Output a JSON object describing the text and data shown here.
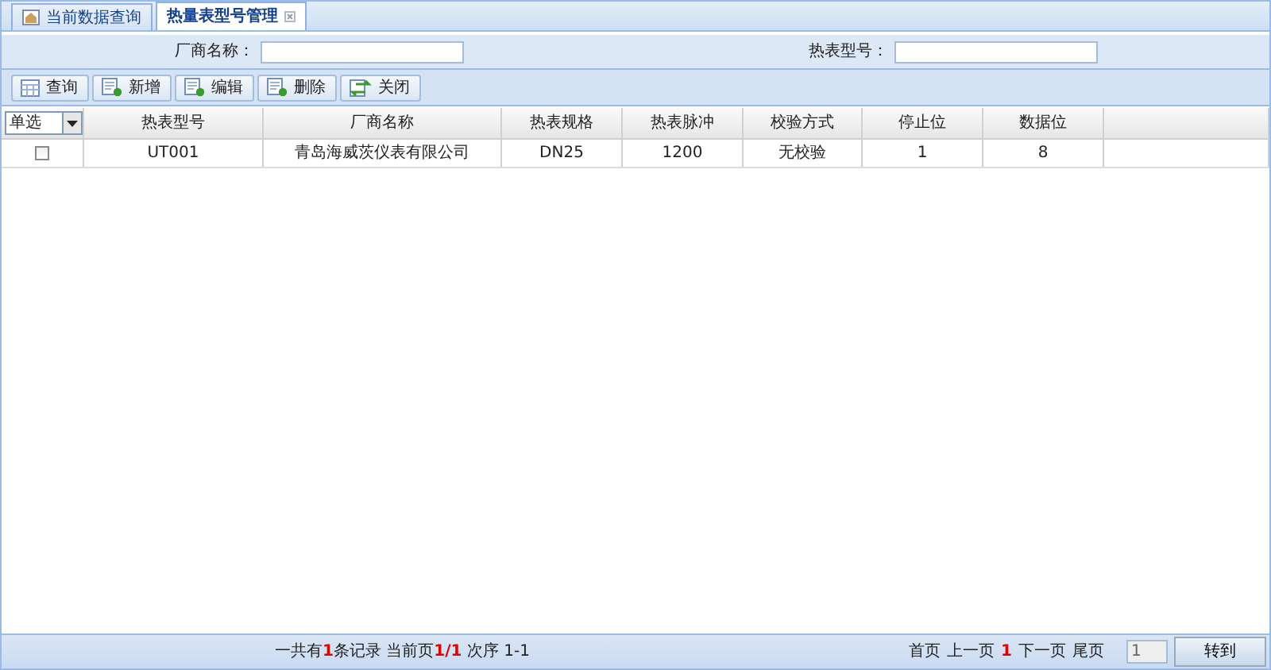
{
  "tabs": [
    {
      "label": "当前数据查询",
      "selected": false,
      "closable": false
    },
    {
      "label": "热量表型号管理",
      "selected": true,
      "closable": true
    }
  ],
  "filters": [
    {
      "label": "厂商名称："
    },
    {
      "label": "热表型号："
    }
  ],
  "toolbar": [
    {
      "label": "查询",
      "kind": "grid"
    },
    {
      "label": "新增",
      "kind": "add"
    },
    {
      "label": "编辑",
      "kind": "add"
    },
    {
      "label": "删除",
      "kind": "add"
    },
    {
      "label": "关闭",
      "kind": "close"
    }
  ],
  "table": {
    "select_mode": "单选",
    "columns": [
      "热表型号",
      "厂商名称",
      "热表规格",
      "热表脉冲",
      "校验方式",
      "停止位",
      "数据位"
    ],
    "rows": [
      {
        "checked": false,
        "cells": [
          "UT001",
          "青岛海威茨仪表有限公司",
          "DN25",
          "1200",
          "无校验",
          "1",
          "8"
        ]
      }
    ]
  },
  "footer": {
    "summary": "一共有**1**条记录 当前页**1/1** 次序 1-1",
    "pager": [
      {
        "label": "首页",
        "kind": "link"
      },
      {
        "label": "上一页",
        "kind": "link"
      },
      {
        "label": "1",
        "kind": "current"
      },
      {
        "label": "下一页",
        "kind": "link"
      },
      {
        "label": "尾页",
        "kind": "link"
      }
    ],
    "page_input": "1",
    "go_button": "转到"
  }
}
